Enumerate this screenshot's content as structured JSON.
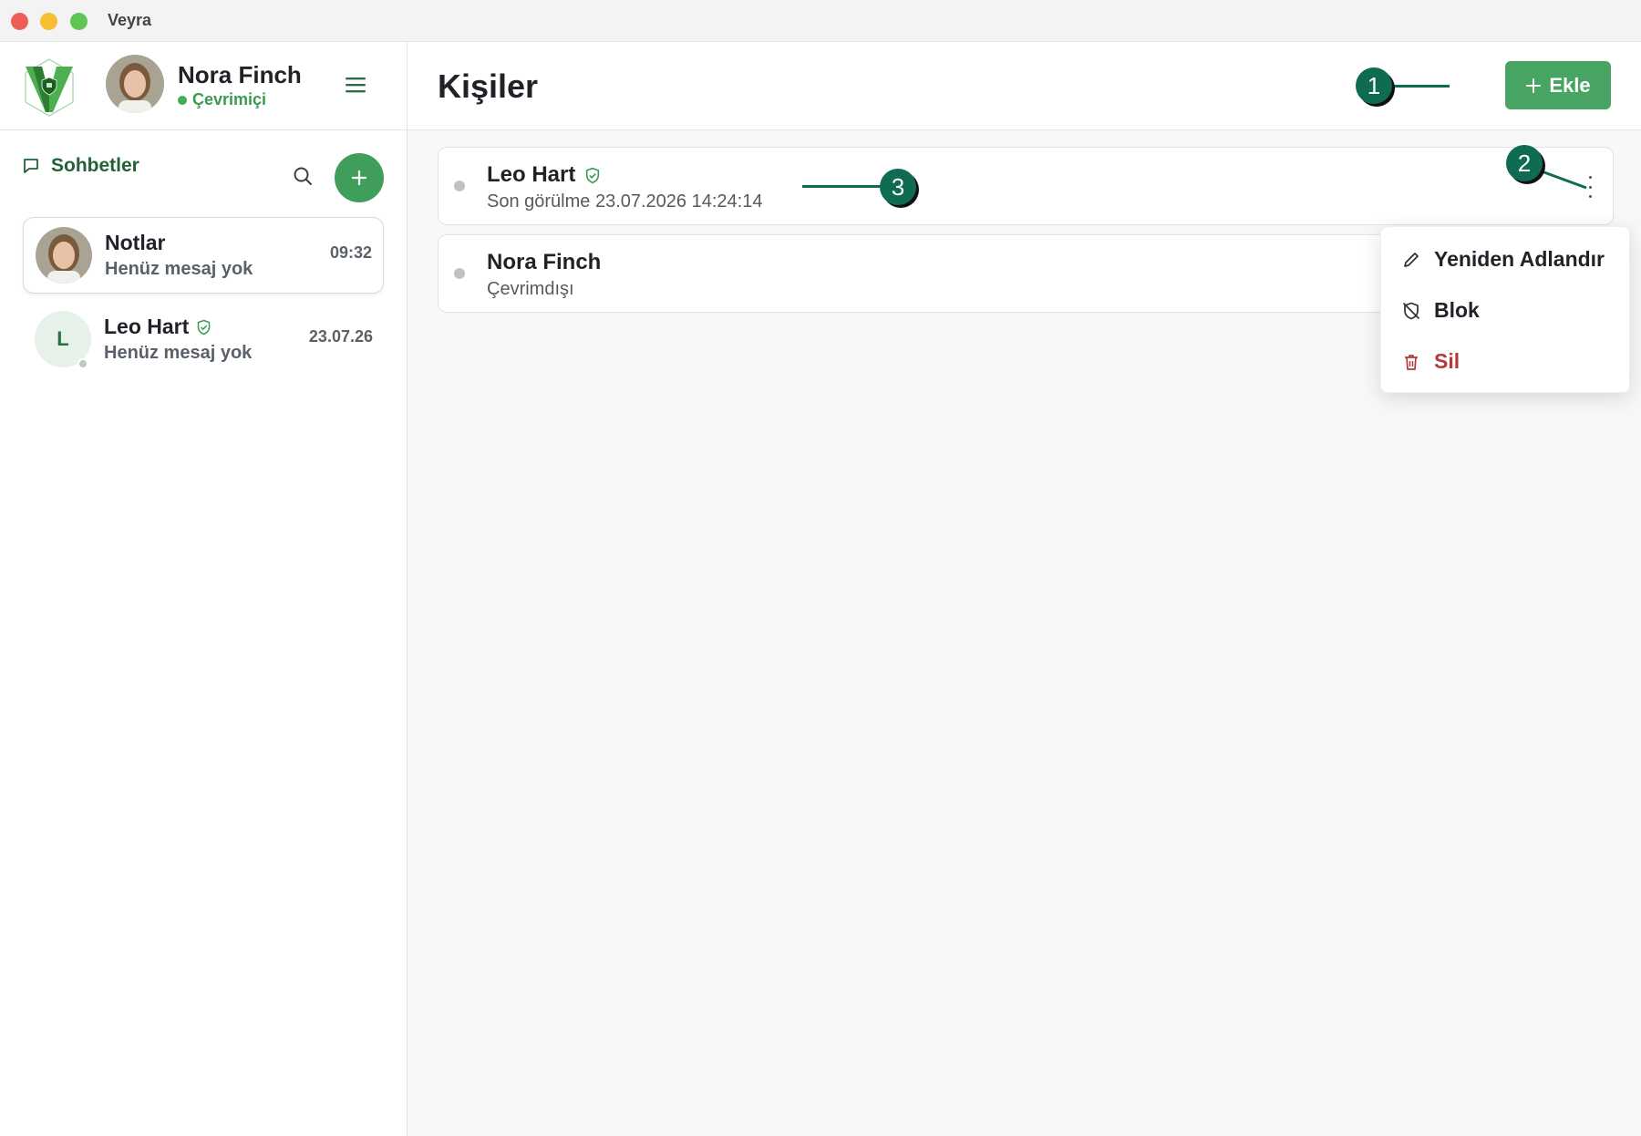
{
  "window": {
    "title": "Veyra"
  },
  "profile": {
    "name": "Nora Finch",
    "status": "Çevrimiçi"
  },
  "sidebar": {
    "section_title": "Sohbetler",
    "chats": [
      {
        "name": "Notlar",
        "preview": "Henüz mesaj yok",
        "time": "09:32",
        "active": true
      },
      {
        "name": "Leo Hart",
        "preview": "Henüz mesaj yok",
        "time": "23.07.26",
        "avatar_letter": "L",
        "verified": true
      }
    ]
  },
  "main": {
    "title": "Kişiler",
    "add_label": "Ekle",
    "contacts": [
      {
        "name": "Leo Hart",
        "subtitle": "Son görülme 23.07.2026 14:24:14",
        "verified": true
      },
      {
        "name": "Nora Finch",
        "subtitle": "Çevrimdışı"
      }
    ]
  },
  "context_menu": {
    "items": [
      {
        "label": "Yeniden Adlandır",
        "icon": "pencil-icon"
      },
      {
        "label": "Blok",
        "icon": "shield-off-icon"
      },
      {
        "label": "Sil",
        "icon": "trash-icon",
        "color": "#b23a3a"
      }
    ]
  },
  "annotations": [
    "1",
    "2",
    "3"
  ],
  "colors": {
    "accent": "#48a463",
    "brand_dark": "#24613a",
    "danger": "#b23a3a",
    "callout": "#0f6b52"
  }
}
